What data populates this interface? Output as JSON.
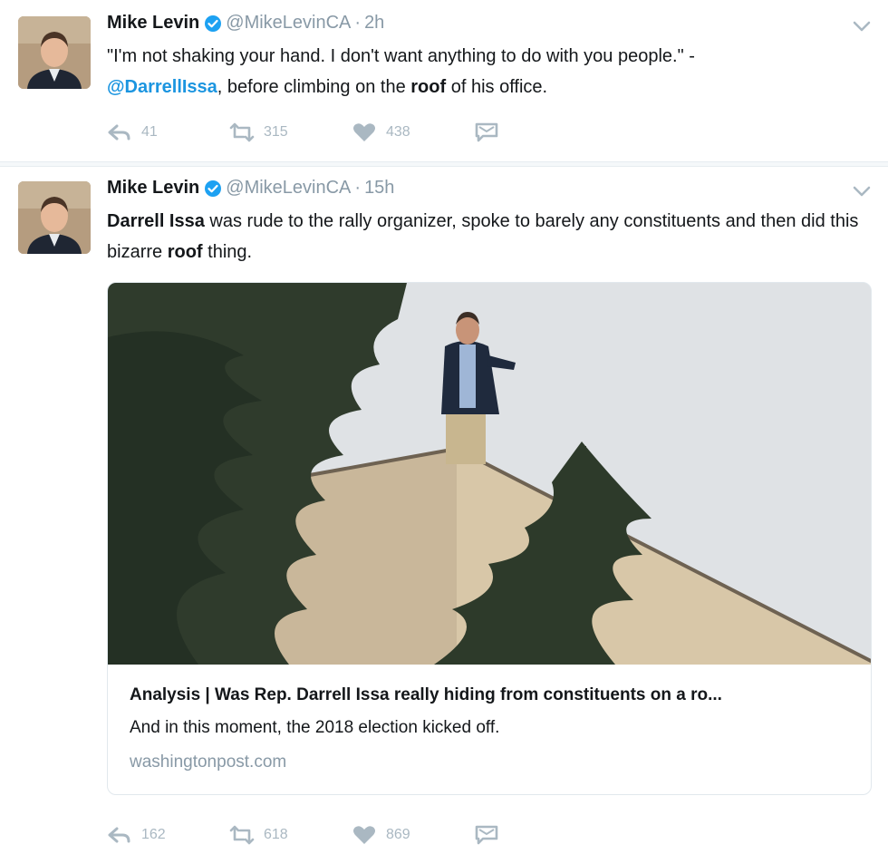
{
  "tweets": [
    {
      "author_name": "Mike Levin",
      "handle": "@MikeLevinCA",
      "separator": "·",
      "time": "2h",
      "text_parts": {
        "quote": "\"I'm not shaking your hand.  I don't want anything to do with you people.\"  -",
        "mention": "@DarrellIssa",
        "middle": ", before climbing on the ",
        "bold": "roof",
        "end": " of his office."
      },
      "counts": {
        "reply": "41",
        "retweet": "315",
        "like": "438"
      }
    },
    {
      "author_name": "Mike Levin",
      "handle": "@MikeLevinCA",
      "separator": "·",
      "time": "15h",
      "text_parts": {
        "bold1": "Darrell Issa",
        "middle": " was rude to the rally organizer, spoke to barely any constituents and then did this bizarre ",
        "bold2": "roof",
        "end": " thing."
      },
      "card": {
        "title": "Analysis | Was Rep. Darrell Issa really hiding from constituents on a ro...",
        "description": "And in this moment, the 2018 election kicked off.",
        "domain": "washingtonpost.com"
      },
      "counts": {
        "reply": "162",
        "retweet": "618",
        "like": "869"
      }
    }
  ],
  "icons": {
    "verified": "verified-badge-icon",
    "caret": "chevron-down-icon",
    "reply": "reply-icon",
    "retweet": "retweet-icon",
    "like": "heart-icon",
    "dm": "direct-message-icon"
  },
  "colors": {
    "link": "#1b95e0",
    "muted": "#8899a6",
    "action": "#aab8c2",
    "verified": "#1da1f2"
  }
}
